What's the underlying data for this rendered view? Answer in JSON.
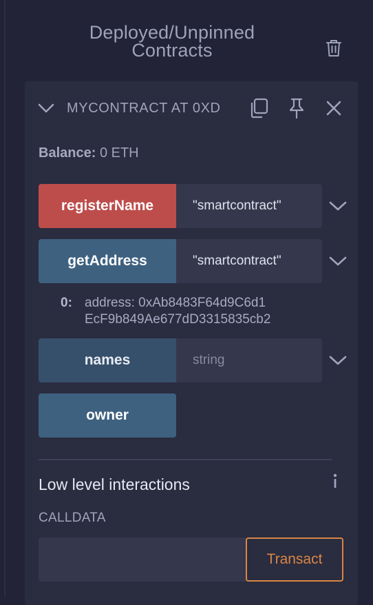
{
  "header": {
    "title": "Deployed/Unpinned Contracts"
  },
  "contract": {
    "name": "MYCONTRACT AT 0XD",
    "balance_label": "Balance:",
    "balance_value": "0 ETH"
  },
  "functions": [
    {
      "name": "registerName",
      "input": "\"smartcontract\"",
      "color": "#bd4d4b"
    },
    {
      "name": "getAddress",
      "input": "\"smartcontract\"",
      "color": "#3e6180"
    },
    {
      "name": "names",
      "placeholder": "string",
      "color": "#36506b"
    },
    {
      "name": "owner",
      "color": "#3e6180"
    }
  ],
  "output": {
    "index": "0:",
    "line1": "address: 0xAb8483F64d9C6d1",
    "line2": "EcF9b849Ae677dD3315835cb2"
  },
  "low_level": {
    "title": "Low level interactions",
    "calldata_label": "CALLDATA",
    "transact_label": "Transact",
    "accent": "#d98646"
  },
  "icons": [
    "trash-icon",
    "chevron-down-icon",
    "copy-icon",
    "pin-icon",
    "close-icon",
    "info-icon"
  ]
}
